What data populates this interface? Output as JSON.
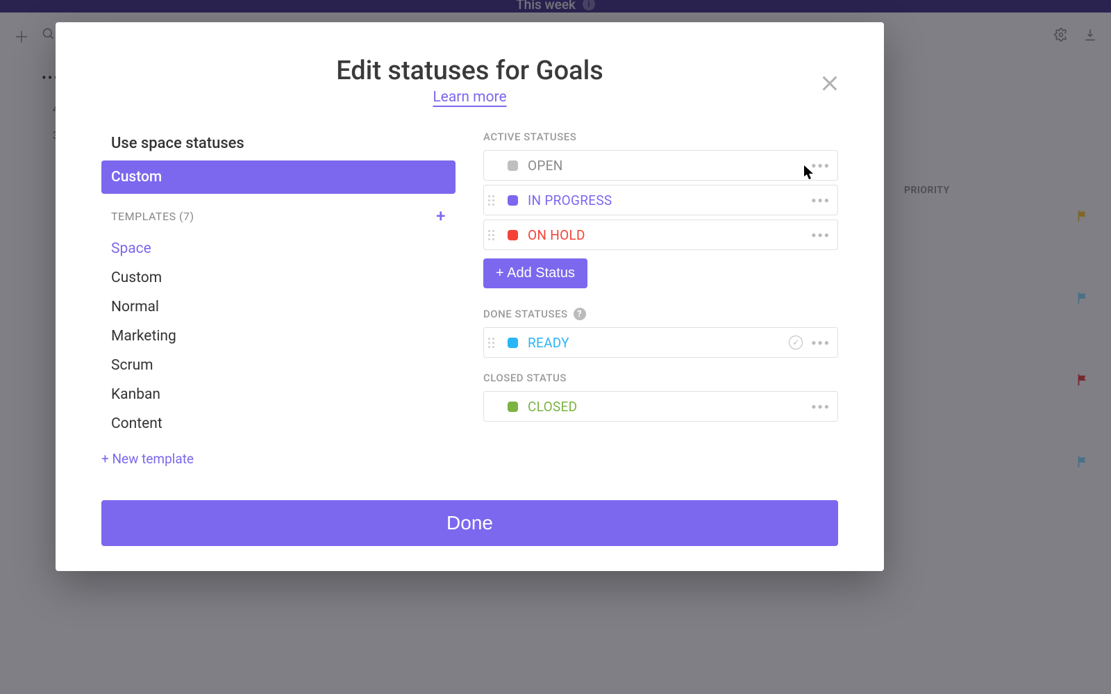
{
  "background": {
    "topbar_title": "This week",
    "priority_header": "PRIORITY"
  },
  "modal": {
    "title": "Edit statuses for Goals",
    "learn_more": "Learn more",
    "left": {
      "use_space": "Use space statuses",
      "custom_label": "Custom",
      "templates_header": "TEMPLATES (7)",
      "templates": [
        {
          "label": "Space",
          "active": true
        },
        {
          "label": "Custom"
        },
        {
          "label": "Normal"
        },
        {
          "label": "Marketing"
        },
        {
          "label": "Scrum"
        },
        {
          "label": "Kanban"
        },
        {
          "label": "Content"
        }
      ],
      "new_template": "+ New template"
    },
    "right": {
      "active_label": "ACTIVE STATUSES",
      "done_label": "DONE STATUSES",
      "closed_label": "CLOSED STATUS",
      "add_status": "+ Add Status",
      "active": [
        {
          "name": "OPEN",
          "color": "#bfbfbf",
          "text_color": "#8a8a8a",
          "draggable": false
        },
        {
          "name": "IN PROGRESS",
          "color": "#7b68ee",
          "text_color": "#7b68ee",
          "draggable": true
        },
        {
          "name": "ON HOLD",
          "color": "#f44336",
          "text_color": "#f44336",
          "draggable": true
        }
      ],
      "done": [
        {
          "name": "READY",
          "color": "#29b6f6",
          "text_color": "#29b6f6",
          "draggable": true,
          "checkmark": true
        }
      ],
      "closed": [
        {
          "name": "CLOSED",
          "color": "#7cb342",
          "text_color": "#7cb342",
          "draggable": false
        }
      ]
    },
    "done_button": "Done"
  }
}
